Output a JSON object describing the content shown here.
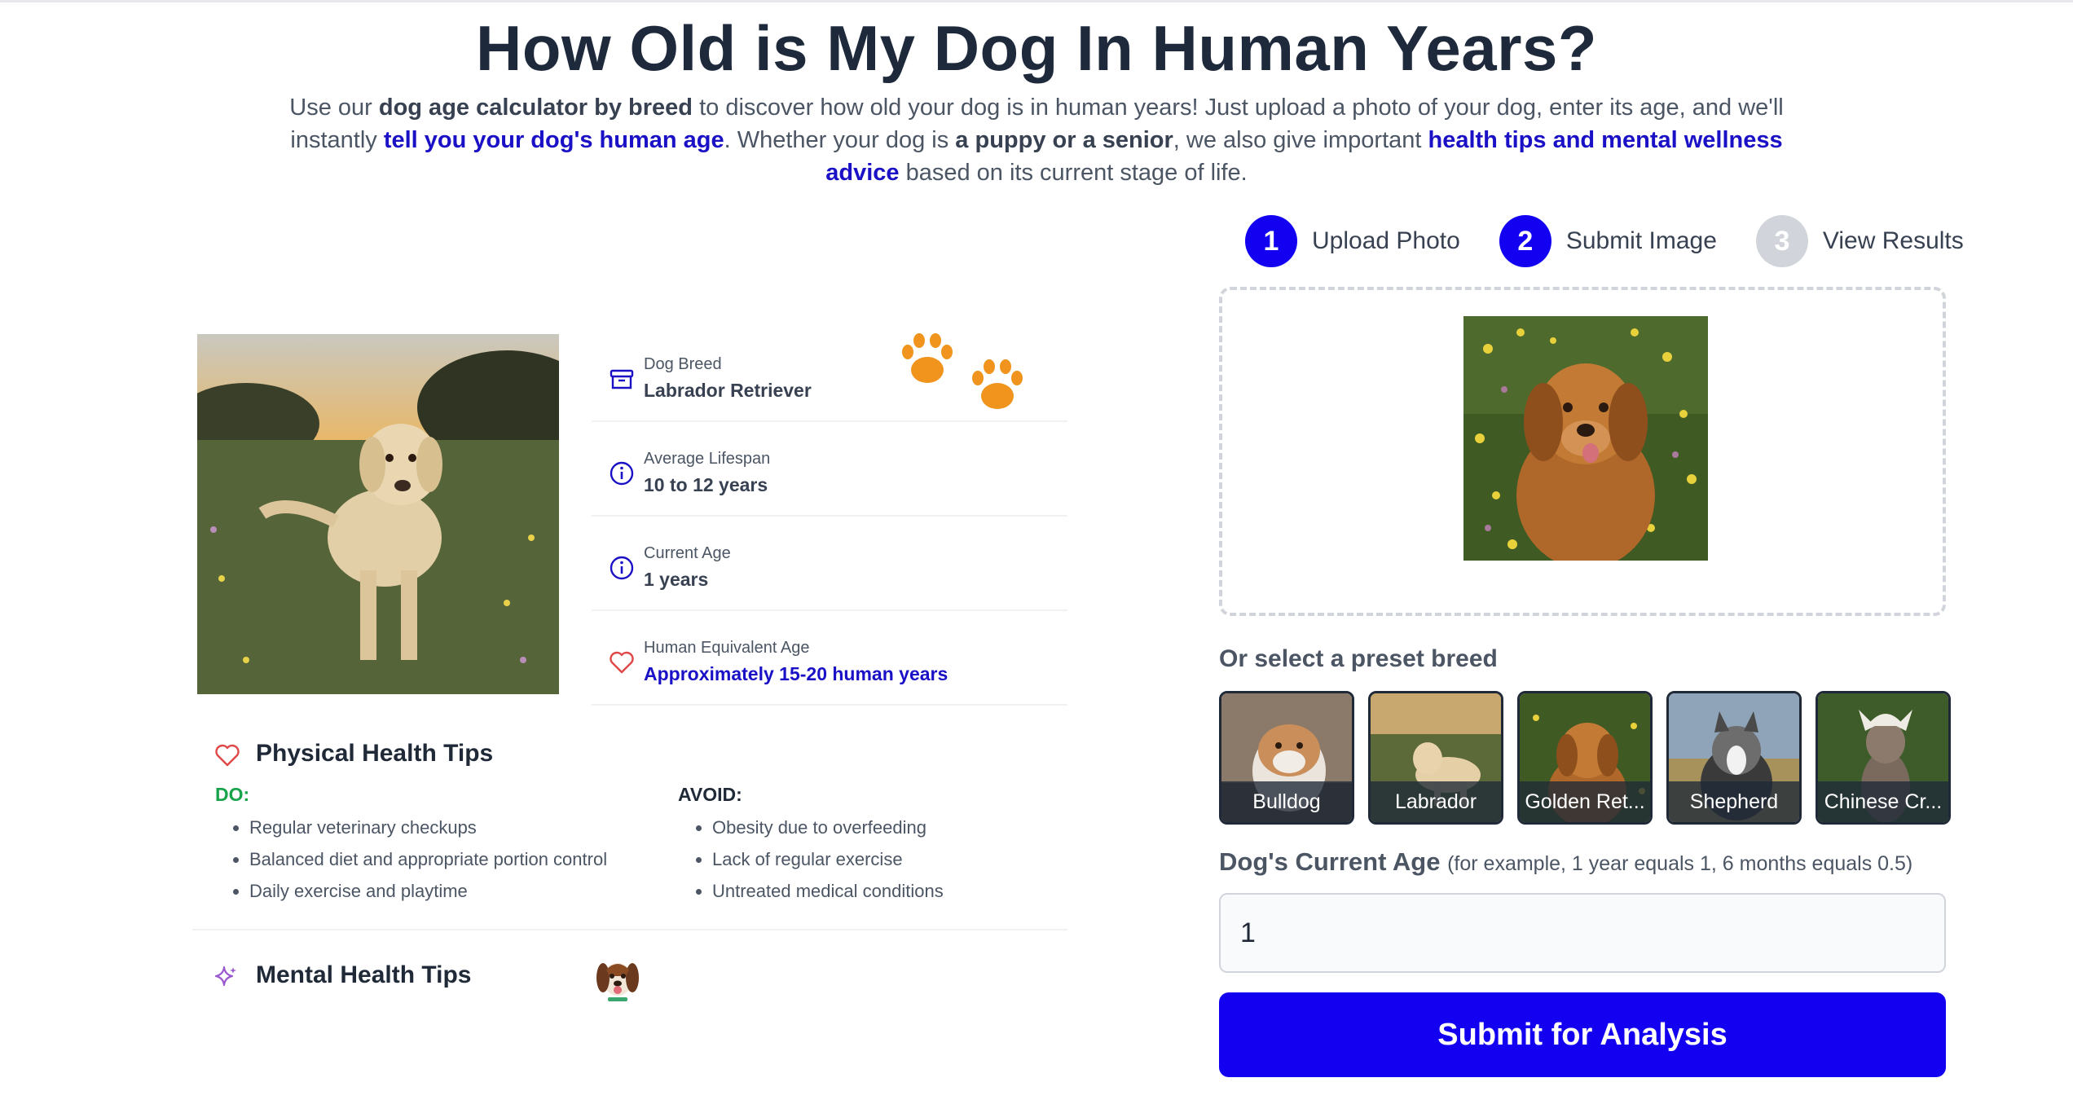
{
  "page": {
    "title": "How Old is My Dog In Human Years?",
    "intro": {
      "t1": "Use our ",
      "b1": "dog age calculator by breed",
      "t2": " to discover how old your dog is in human years! Just upload a photo of your dog, enter its age, and we'll instantly ",
      "h1": "tell you your dog's human age",
      "t3": ". Whether your dog is ",
      "b2": "a puppy or a senior",
      "t4": ", we also give important ",
      "h2": "health tips and mental wellness advice",
      "t5": " based on its current stage of life."
    }
  },
  "steps": [
    {
      "num": "1",
      "label": "Upload Photo",
      "active": true
    },
    {
      "num": "2",
      "label": "Submit Image",
      "active": true
    },
    {
      "num": "3",
      "label": "View Results",
      "active": false
    }
  ],
  "presets": {
    "heading": "Or select a preset breed",
    "items": [
      "Bulldog",
      "Labrador",
      "Golden Ret...",
      "Shepherd",
      "Chinese Cr..."
    ]
  },
  "age": {
    "label": "Dog's Current Age",
    "note": "(for example, 1 year equals 1, 6 months equals 0.5)",
    "value": "1"
  },
  "submit_label": "Submit for Analysis",
  "info": [
    {
      "label": "Dog Breed",
      "value": "Labrador Retriever",
      "icon": "box-icon"
    },
    {
      "label": "Average Lifespan",
      "value": "10 to 12 years",
      "icon": "info-icon"
    },
    {
      "label": "Current Age",
      "value": "1 years",
      "icon": "info-icon"
    },
    {
      "label": "Human Equivalent Age",
      "value": "Approximately 15-20 human years",
      "icon": "heart-icon"
    }
  ],
  "physical": {
    "title": "Physical Health Tips",
    "do_title": "DO:",
    "do": [
      "Regular veterinary checkups",
      "Balanced diet and appropriate portion control",
      "Daily exercise and playtime"
    ],
    "avoid_title": "AVOID:",
    "avoid": [
      "Obesity due to overfeeding",
      "Lack of regular exercise",
      "Untreated medical conditions"
    ]
  },
  "mental": {
    "title": "Mental Health Tips"
  },
  "colors": {
    "primary": "#1300f0",
    "link": "#1a10c6",
    "do_green": "#16a34a",
    "paw": "#f0941e"
  }
}
